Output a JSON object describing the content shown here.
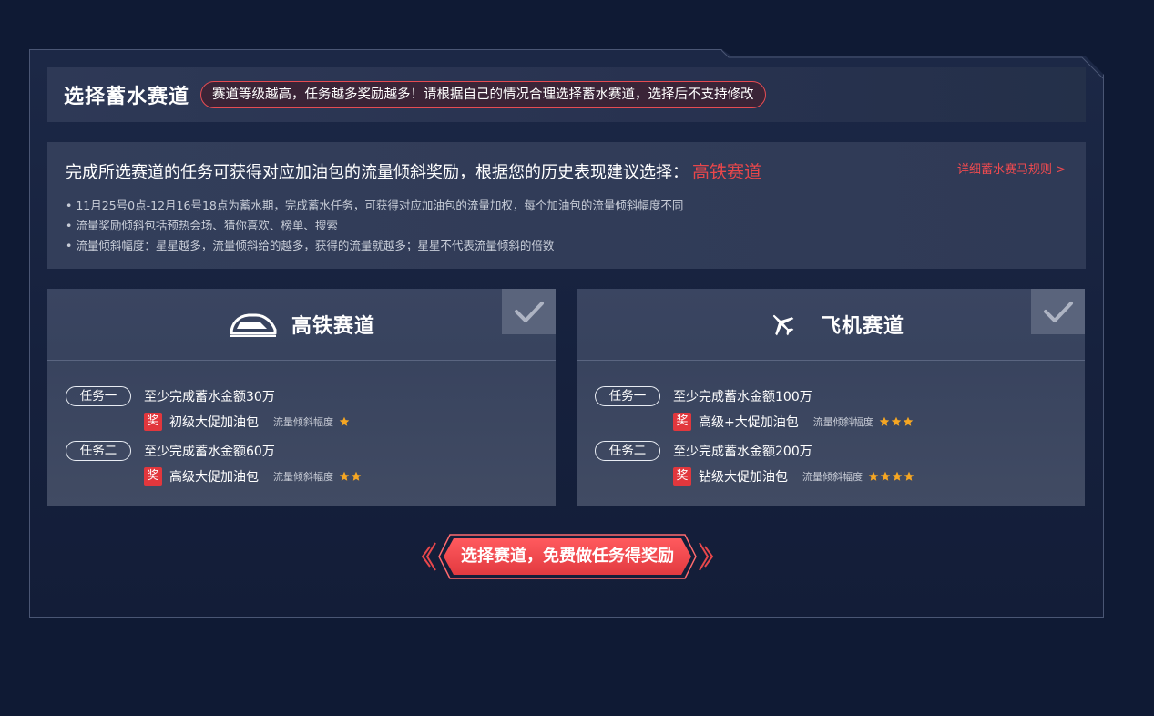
{
  "header": {
    "title": "选择蓄水赛道",
    "tip": "赛道等级越高，任务越多奖励越多！请根据自己的情况合理选择蓄水赛道，选择后不支持修改"
  },
  "info": {
    "headline": "完成所选赛道的任务可获得对应加油包的流量倾斜奖励，根据您的历史表现建议选择：",
    "suggested_track": "高铁赛道",
    "rules_link": "详细蓄水赛马规则 >",
    "bullets": [
      "11月25号0点-12月16号18点为蓄水期，完成蓄水任务，可获得对应加油包的流量加权，每个加油包的流量倾斜幅度不同",
      "流量奖励倾斜包括预热会场、猜你喜欢、榜单、搜索",
      "流量倾斜幅度：星星越多，流量倾斜给的越多，获得的流量就越多；星星不代表流量倾斜的倍数"
    ]
  },
  "tracks": [
    {
      "title": "高铁赛道",
      "icon": "train-icon",
      "tasks": [
        {
          "badge": "任务一",
          "desc": "至少完成蓄水金额30万",
          "award_tag": "奖",
          "award": "初级大促加油包",
          "slope_label": "流量倾斜幅度",
          "stars": 1
        },
        {
          "badge": "任务二",
          "desc": "至少完成蓄水金额60万",
          "award_tag": "奖",
          "award": "高级大促加油包",
          "slope_label": "流量倾斜幅度",
          "stars": 2
        }
      ]
    },
    {
      "title": "飞机赛道",
      "icon": "airplane-icon",
      "tasks": [
        {
          "badge": "任务一",
          "desc": "至少完成蓄水金额100万",
          "award_tag": "奖",
          "award": "高级+大促加油包",
          "slope_label": "流量倾斜幅度",
          "stars": 3
        },
        {
          "badge": "任务二",
          "desc": "至少完成蓄水金额200万",
          "award_tag": "奖",
          "award": "钻级大促加油包",
          "slope_label": "流量倾斜幅度",
          "stars": 4
        }
      ]
    }
  ],
  "cta": {
    "label": "选择赛道，免费做任务得奖励"
  },
  "colors": {
    "background": "#0f1a34",
    "accent_red": "#e8474b",
    "star": "#f5a623",
    "check": "#aeb4c3"
  }
}
